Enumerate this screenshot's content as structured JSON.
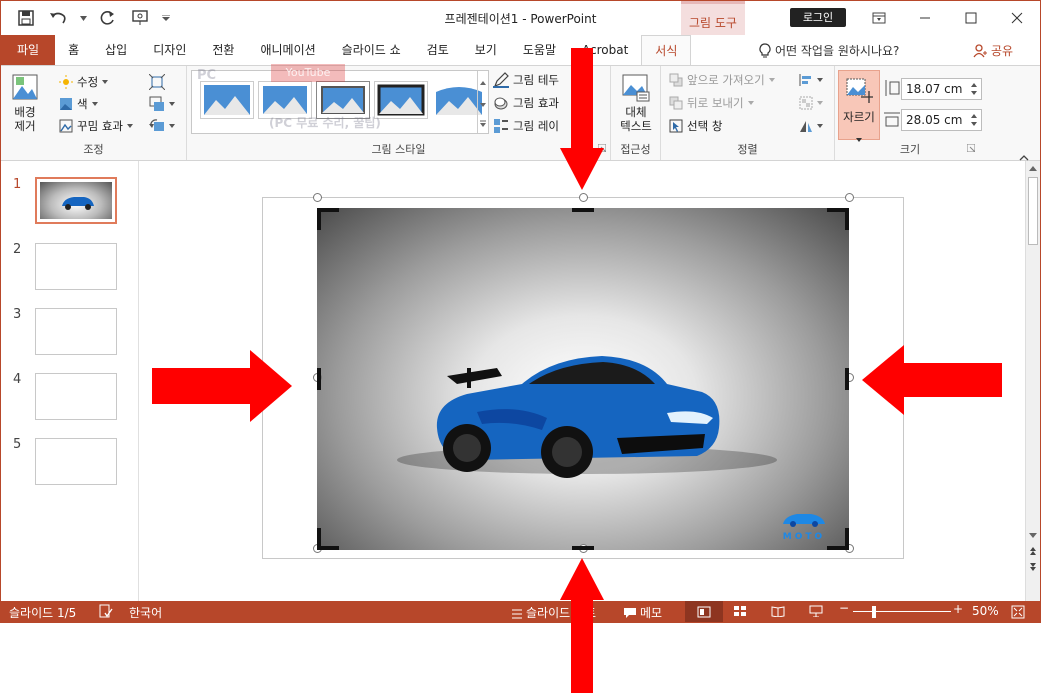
{
  "window": {
    "title": "프레젠테이션1  -  PowerPoint",
    "tool_tab": "그림 도구",
    "login": "로그인"
  },
  "tabs": [
    "파일",
    "홈",
    "삽입",
    "디자인",
    "전환",
    "애니메이션",
    "슬라이드 쇼",
    "검토",
    "보기",
    "도움말",
    "Acrobat",
    "서식"
  ],
  "tell_me": "어떤 작업을 원하시나요?",
  "share": "공유",
  "ribbon": {
    "adjust": {
      "remove_bg": [
        "배경",
        "제거"
      ],
      "corrections": "수정",
      "color": "색",
      "artistic": "꾸밈 효과",
      "label": "조정"
    },
    "styles": {
      "border": "그림 테두",
      "effects": "그림 효과",
      "layout": "그림 레이",
      "label": "그림 스타일"
    },
    "accessibility": {
      "alt_text": [
        "대체",
        "텍스트"
      ],
      "label": "접근성"
    },
    "arrange": {
      "bring_forward": "앞으로 가져오기",
      "send_backward": "뒤로 보내기",
      "selection_pane": "선택 창",
      "label": "정렬"
    },
    "size": {
      "crop": "자르기",
      "height": "18.07 cm",
      "width": "28.05 cm",
      "label": "크기"
    }
  },
  "watermark": {
    "line1": "PC",
    "line2": "YouTube",
    "line3": "(PC 무료 수리, 꿀팁)"
  },
  "slides": [
    "1",
    "2",
    "3",
    "4",
    "5"
  ],
  "photo_logo": "MOTO",
  "status": {
    "slide_pos": "슬라이드 1/5",
    "language": "한국어",
    "notes": "슬라이드 노트",
    "comments": "메모",
    "zoom": "50%"
  },
  "colors": {
    "accent": "#b7472a",
    "arrow": "#ff0000",
    "car_blue": "#1565c0"
  }
}
